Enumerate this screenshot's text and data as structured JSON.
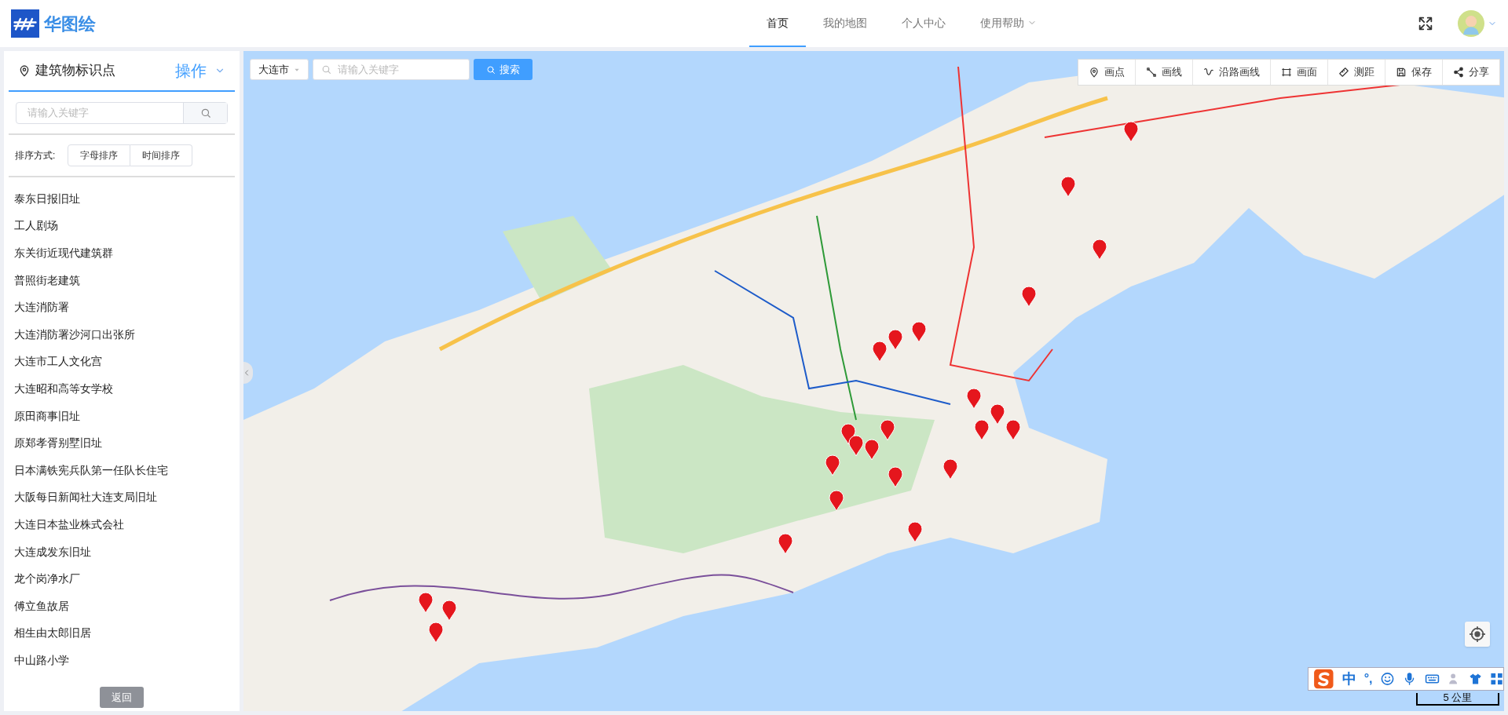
{
  "header": {
    "logo_text": "华图绘",
    "nav": [
      {
        "label": "首页",
        "selected": true,
        "dropdown": false
      },
      {
        "label": "我的地图",
        "selected": false,
        "dropdown": false
      },
      {
        "label": "个人中心",
        "selected": false,
        "dropdown": false
      },
      {
        "label": "使用帮助",
        "selected": false,
        "dropdown": true
      }
    ]
  },
  "sidebar": {
    "title": "建筑物标识点",
    "action": "操作",
    "search": {
      "placeholder": "请输入关键字"
    },
    "sort_label": "排序方式:",
    "sort_buttons": [
      "字母排序",
      "时间排序"
    ],
    "items": [
      "泰东日报旧址",
      "工人剧场",
      "东关街近现代建筑群",
      "普照街老建筑",
      "大连消防署",
      "大连消防署沙河口出张所",
      "大连市工人文化宫",
      "大连昭和高等女学校",
      "原田商事旧址",
      "原郑孝胥别墅旧址",
      "日本满铁宪兵队第一任队长住宅",
      "大阪每日新闻社大连支局旧址",
      "大连日本盐业株式会社",
      "大连成发东旧址",
      "龙个岗净水厂",
      "傅立鱼故居",
      "相生由太郎旧居",
      "中山路小学"
    ],
    "back_button": "返回"
  },
  "map": {
    "city": "大连市",
    "search": {
      "placeholder": "请输入关键字"
    },
    "search_button": "搜索",
    "tools": [
      {
        "kind": "point",
        "label": "画点"
      },
      {
        "kind": "line",
        "label": "画线"
      },
      {
        "kind": "route",
        "label": "沿路画线"
      },
      {
        "kind": "area",
        "label": "画面"
      },
      {
        "kind": "measure",
        "label": "测距"
      },
      {
        "kind": "save",
        "label": "保存"
      },
      {
        "kind": "share",
        "label": "分享"
      }
    ],
    "scale": "5 公里"
  },
  "ime_bar": {
    "mode": "中",
    "punct": "°,"
  }
}
